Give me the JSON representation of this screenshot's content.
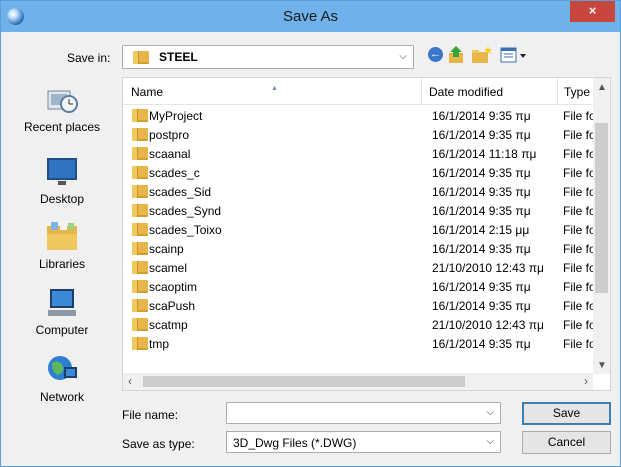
{
  "window": {
    "title": "Save As",
    "close_glyph": "×"
  },
  "toolbar": {
    "save_in_label": "Save in:",
    "save_in_value": "STEEL",
    "icons": [
      "back-icon",
      "up-folder-icon",
      "new-folder-icon",
      "view-menu-icon"
    ]
  },
  "places": [
    {
      "label": "Recent places",
      "icon": "recent-places-icon"
    },
    {
      "label": "Desktop",
      "icon": "desktop-icon"
    },
    {
      "label": "Libraries",
      "icon": "libraries-icon"
    },
    {
      "label": "Computer",
      "icon": "computer-icon"
    },
    {
      "label": "Network",
      "icon": "network-icon"
    }
  ],
  "file_list": {
    "columns": {
      "name": "Name",
      "date": "Date modified",
      "type": "Type"
    },
    "rows": [
      {
        "name": "MyProject",
        "date": "16/1/2014 9:35 πμ",
        "type": "File fol"
      },
      {
        "name": "postpro",
        "date": "16/1/2014 9:35 πμ",
        "type": "File fol"
      },
      {
        "name": "scaanal",
        "date": "16/1/2014 11:18 πμ",
        "type": "File fol"
      },
      {
        "name": "scades_c",
        "date": "16/1/2014 9:35 πμ",
        "type": "File fol"
      },
      {
        "name": "scades_Sid",
        "date": "16/1/2014 9:35 πμ",
        "type": "File fol"
      },
      {
        "name": "scades_Synd",
        "date": "16/1/2014 9:35 πμ",
        "type": "File fol"
      },
      {
        "name": "scades_Toixo",
        "date": "16/1/2014 2:15 μμ",
        "type": "File fol"
      },
      {
        "name": "scainp",
        "date": "16/1/2014 9:35 πμ",
        "type": "File fol"
      },
      {
        "name": "scamel",
        "date": "21/10/2010 12:43 πμ",
        "type": "File fol"
      },
      {
        "name": "scaoptim",
        "date": "16/1/2014 9:35 πμ",
        "type": "File fol"
      },
      {
        "name": "scaPush",
        "date": "16/1/2014 9:35 πμ",
        "type": "File fol"
      },
      {
        "name": "scatmp",
        "date": "21/10/2010 12:43 πμ",
        "type": "File fol"
      },
      {
        "name": "tmp",
        "date": "16/1/2014 9:35 πμ",
        "type": "File fol"
      }
    ]
  },
  "footer": {
    "file_name_label": "File name:",
    "file_name_value": "",
    "save_as_type_label": "Save as type:",
    "save_as_type_value": "3D_Dwg Files (*.DWG)",
    "save_button": "Save",
    "cancel_button": "Cancel"
  }
}
